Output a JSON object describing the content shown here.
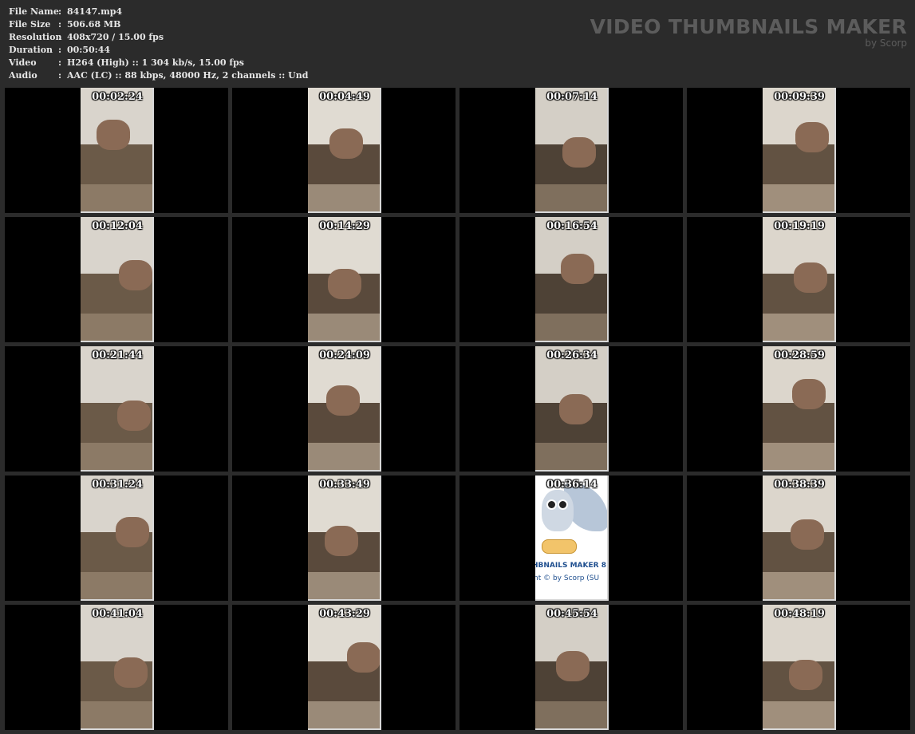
{
  "info": [
    {
      "key": "File Name",
      "sep": ":",
      "value": "84147.mp4"
    },
    {
      "key": "File Size",
      "sep": ":",
      "value": "506.68 MB"
    },
    {
      "key": "Resolution",
      "sep": ":",
      "value": "408x720 / 15.00 fps"
    },
    {
      "key": "Duration",
      "sep": ":",
      "value": "00:50:44"
    },
    {
      "key": "Video",
      "sep": ":",
      "value": "H264 (High) :: 1 304 kb/s, 15.00 fps"
    },
    {
      "key": "Audio",
      "sep": ":",
      "value": "AAC (LC) :: 88 kbps, 48000 Hz, 2 channels :: Und"
    }
  ],
  "brand": {
    "title": "VIDEO THUMBNAILS MAKER",
    "subtitle": "by Scorp"
  },
  "logo": {
    "text": "HBNAILS MAKER 8",
    "copyright": "nt © by Scorp (SU"
  },
  "thumbnails": [
    {
      "time": "00:02:24",
      "kind": "room"
    },
    {
      "time": "00:04:49",
      "kind": "room"
    },
    {
      "time": "00:07:14",
      "kind": "room"
    },
    {
      "time": "00:09:39",
      "kind": "room"
    },
    {
      "time": "00:12:04",
      "kind": "room"
    },
    {
      "time": "00:14:29",
      "kind": "room"
    },
    {
      "time": "00:16:54",
      "kind": "room"
    },
    {
      "time": "00:19:19",
      "kind": "room"
    },
    {
      "time": "00:21:44",
      "kind": "room"
    },
    {
      "time": "00:24:09",
      "kind": "room"
    },
    {
      "time": "00:26:34",
      "kind": "room"
    },
    {
      "time": "00:28:59",
      "kind": "room"
    },
    {
      "time": "00:31:24",
      "kind": "room"
    },
    {
      "time": "00:33:49",
      "kind": "room"
    },
    {
      "time": "00:36:14",
      "kind": "logo"
    },
    {
      "time": "00:38:39",
      "kind": "room"
    },
    {
      "time": "00:41:04",
      "kind": "room"
    },
    {
      "time": "00:43:29",
      "kind": "room"
    },
    {
      "time": "00:45:54",
      "kind": "room"
    },
    {
      "time": "00:48:19",
      "kind": "room"
    }
  ],
  "colors": {
    "background": "#2b2b2b",
    "cell": "#000000",
    "info_text": "#e6e6e6",
    "brand_text": "#5c5c5c"
  }
}
